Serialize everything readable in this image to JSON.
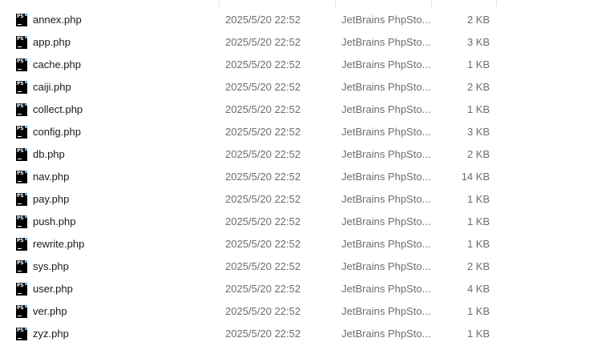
{
  "files": [
    {
      "name": "annex.php",
      "modified": "2025/5/20 22:52",
      "type": "JetBrains PhpSto...",
      "size": "2 KB"
    },
    {
      "name": "app.php",
      "modified": "2025/5/20 22:52",
      "type": "JetBrains PhpSto...",
      "size": "3 KB"
    },
    {
      "name": "cache.php",
      "modified": "2025/5/20 22:52",
      "type": "JetBrains PhpSto...",
      "size": "1 KB"
    },
    {
      "name": "caiji.php",
      "modified": "2025/5/20 22:52",
      "type": "JetBrains PhpSto...",
      "size": "2 KB"
    },
    {
      "name": "collect.php",
      "modified": "2025/5/20 22:52",
      "type": "JetBrains PhpSto...",
      "size": "1 KB"
    },
    {
      "name": "config.php",
      "modified": "2025/5/20 22:52",
      "type": "JetBrains PhpSto...",
      "size": "3 KB"
    },
    {
      "name": "db.php",
      "modified": "2025/5/20 22:52",
      "type": "JetBrains PhpSto...",
      "size": "2 KB"
    },
    {
      "name": "nav.php",
      "modified": "2025/5/20 22:52",
      "type": "JetBrains PhpSto...",
      "size": "14 KB"
    },
    {
      "name": "pay.php",
      "modified": "2025/5/20 22:52",
      "type": "JetBrains PhpSto...",
      "size": "1 KB"
    },
    {
      "name": "push.php",
      "modified": "2025/5/20 22:52",
      "type": "JetBrains PhpSto...",
      "size": "1 KB"
    },
    {
      "name": "rewrite.php",
      "modified": "2025/5/20 22:52",
      "type": "JetBrains PhpSto...",
      "size": "1 KB"
    },
    {
      "name": "sys.php",
      "modified": "2025/5/20 22:52",
      "type": "JetBrains PhpSto...",
      "size": "2 KB"
    },
    {
      "name": "user.php",
      "modified": "2025/5/20 22:52",
      "type": "JetBrains PhpSto...",
      "size": "4 KB"
    },
    {
      "name": "ver.php",
      "modified": "2025/5/20 22:52",
      "type": "JetBrains PhpSto...",
      "size": "1 KB"
    },
    {
      "name": "zyz.php",
      "modified": "2025/5/20 22:52",
      "type": "JetBrains PhpSto...",
      "size": "1 KB"
    }
  ],
  "file_icon": {
    "semantic": "phpstorm-file-icon",
    "text": "PS",
    "background_color": "#000000",
    "accent_color": "#5fb4f5"
  },
  "colors": {
    "name_text": "#1a1a1a",
    "meta_text": "#6d6d6d",
    "row_hover": "#e5f3ff"
  }
}
